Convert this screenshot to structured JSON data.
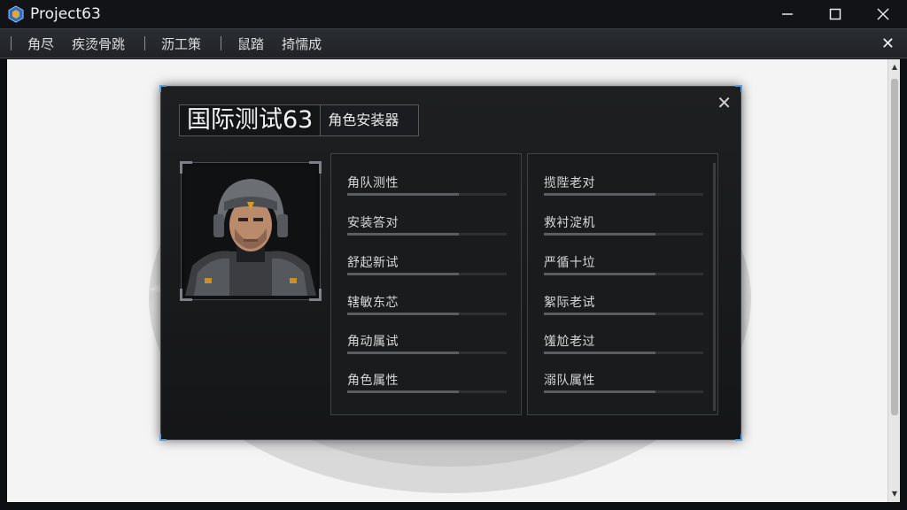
{
  "window": {
    "title": "Project63",
    "minimize_icon": "minimize-icon",
    "maximize_icon": "maximize-icon",
    "close_icon": "close-icon"
  },
  "menu": {
    "items": [
      "角尽",
      "疾烫骨跳",
      "沥工策",
      "鼠踏",
      "掎懦成"
    ],
    "close_glyph": "✕"
  },
  "dialog": {
    "title": "国际测试63",
    "subtitle": "角色安装器",
    "close_glyph": "✕",
    "left_rows": [
      {
        "label": "角队测性",
        "fill": 0.7
      },
      {
        "label": "安装答对",
        "fill": 0.7
      },
      {
        "label": "舒起新试",
        "fill": 0.7
      },
      {
        "label": "辖敏东芯",
        "fill": 0.7
      },
      {
        "label": "角动属试",
        "fill": 0.7
      },
      {
        "label": "角色属性",
        "fill": 0.7
      }
    ],
    "right_rows": [
      {
        "label": "揽陛老对",
        "fill": 0.7
      },
      {
        "label": "救衬淀机",
        "fill": 0.7
      },
      {
        "label": "严循十垃",
        "fill": 0.7
      },
      {
        "label": "絮际老试",
        "fill": 0.7
      },
      {
        "label": "馐尬老过",
        "fill": 0.7
      },
      {
        "label": "溺队属性",
        "fill": 0.7
      }
    ]
  },
  "colors": {
    "accent": "#5aa0e0",
    "dialog_bg": "#1a1b1d",
    "content_bg": "#f4f4f4"
  }
}
